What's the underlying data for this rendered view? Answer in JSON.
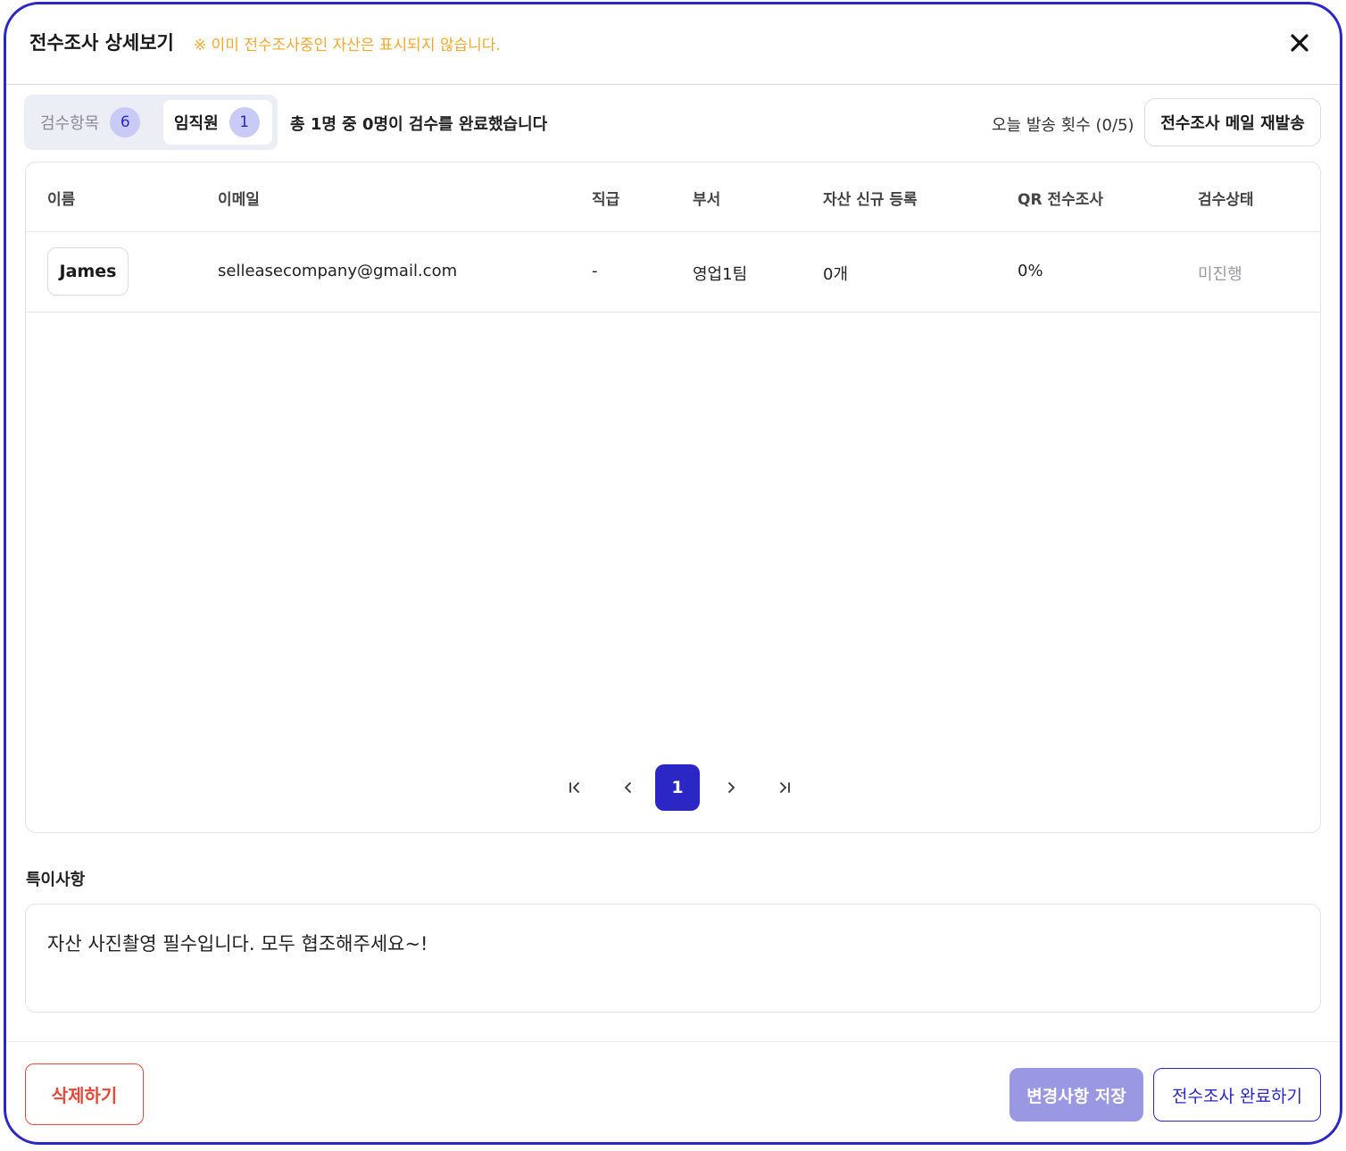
{
  "header": {
    "title": "전수조사 상세보기",
    "notice": "※ 이미 전수조사중인 자산은 표시되지 않습니다."
  },
  "tabs": [
    {
      "label": "검수항목",
      "count": "6"
    },
    {
      "label": "임직원",
      "count": "1"
    }
  ],
  "summary": "총 1명 중 0명이 검수를 완료했습니다",
  "send_count": "오늘 발송 횟수 (0/5)",
  "resend_label": "전수조사 메일 재발송",
  "table": {
    "columns": [
      "이름",
      "이메일",
      "직급",
      "부서",
      "자산 신규 등록",
      "QR 전수조사",
      "검수상태"
    ],
    "rows": [
      {
        "name": "James",
        "email": "selleasecompany@gmail.com",
        "rank": "-",
        "department": "영업1팀",
        "new_assets": "0개",
        "qr_progress": "0%",
        "status": "미진행"
      }
    ]
  },
  "pagination": {
    "current": "1"
  },
  "remarks": {
    "label": "특이사항",
    "text": "자산 사진촬영 필수입니다. 모두 협조해주세요~!"
  },
  "footer": {
    "delete_label": "삭제하기",
    "save_label": "변경사항 저장",
    "complete_label": "전수조사 완료하기"
  },
  "icons": {
    "close": "close-icon",
    "first_page": "first-page-icon",
    "prev_page": "prev-page-icon",
    "next_page": "next-page-icon",
    "last_page": "last-page-icon"
  },
  "colors": {
    "accent": "#2b27c4",
    "notice": "#f0a832",
    "danger": "#e24a3b",
    "save_button": "#9a98e3",
    "badge": "#c9caf5"
  }
}
